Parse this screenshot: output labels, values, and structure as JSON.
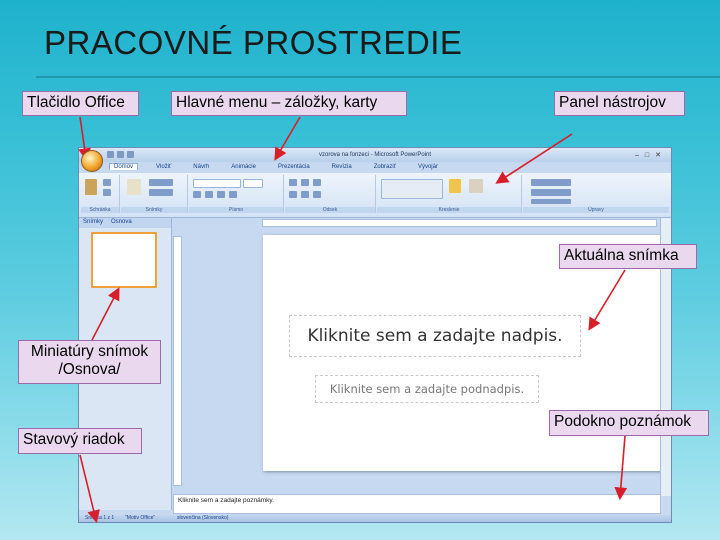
{
  "slide": {
    "title": "PRACOVNÉ PROSTREDIE"
  },
  "callouts": {
    "office_button": "Tlačidlo Office",
    "main_menu": "Hlavné menu – záložky, karty",
    "toolbar_panel": "Panel nástrojov",
    "current_slide": "Aktuálna snímka",
    "thumbnails": "Miniatúry snímok /Osnova/",
    "status_bar": "Stavový riadok",
    "notes_pane": "Podokno poznámok"
  },
  "powerpoint": {
    "window_title": "vzorova na fonzeci - Microsoft PowerPoint",
    "tabs": [
      "Domov",
      "Vložiť",
      "Návrh",
      "Animácie",
      "Prezentácia",
      "Revízia",
      "Zobraziť",
      "Vývojár"
    ],
    "ribbon_groups": [
      "Schránka",
      "Snímky",
      "Písmo",
      "Odsek",
      "Kreslenie",
      "Úpravy"
    ],
    "pane_tabs": [
      "Snímky",
      "Osnova"
    ],
    "title_placeholder": "Kliknite sem a zadajte nadpis.",
    "subtitle_placeholder": "Kliknite sem a zadajte podnadpis.",
    "notes_placeholder": "Kliknite sem a zadajte poznámky.",
    "status": {
      "slide_counter": "Snímka 1 z 1",
      "theme": "\"Motív Office\"",
      "language": "slovenčina (Slovensko)"
    }
  },
  "colors": {
    "background_top": "#1fb2cc",
    "callout_fill": "#ead8ef",
    "arrow": "#d81e2b"
  }
}
